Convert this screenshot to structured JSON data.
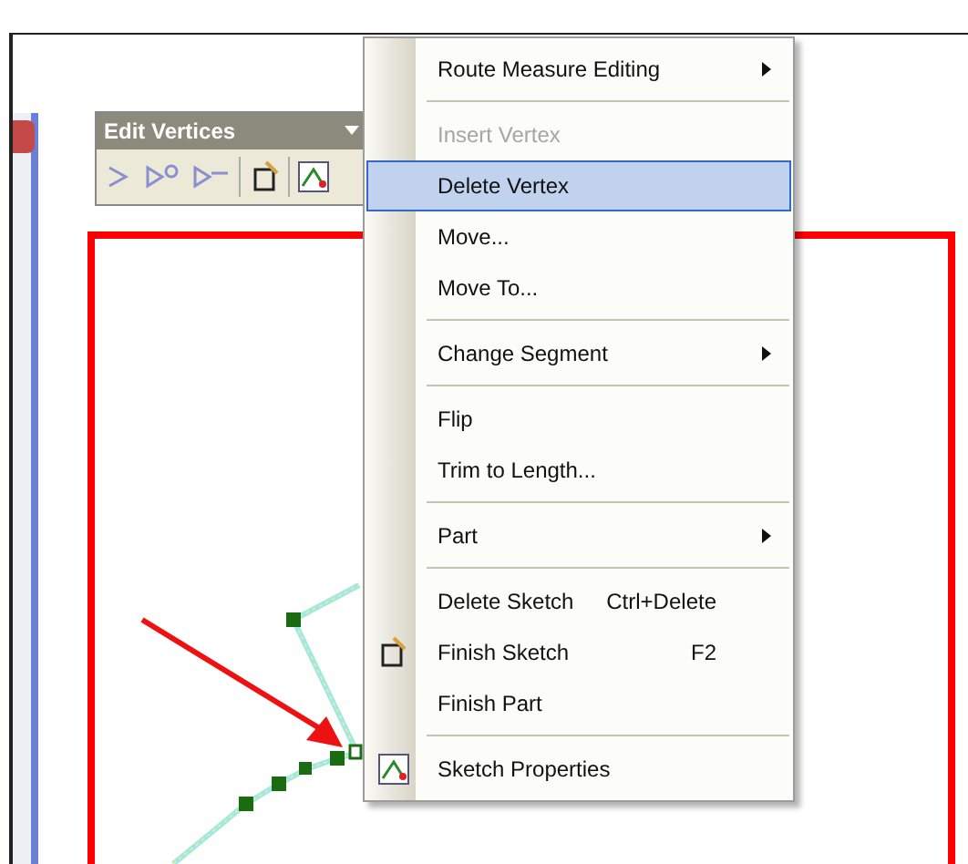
{
  "toolbar": {
    "title": "Edit Vertices"
  },
  "menu": {
    "items": [
      {
        "kind": "item",
        "label": "Route Measure Editing",
        "submenu": true,
        "disabled": false,
        "selected": false
      },
      {
        "kind": "separator"
      },
      {
        "kind": "item",
        "label": "Insert Vertex",
        "submenu": false,
        "disabled": true,
        "selected": false
      },
      {
        "kind": "item",
        "label": "Delete Vertex",
        "submenu": false,
        "disabled": false,
        "selected": true
      },
      {
        "kind": "item",
        "label": "Move...",
        "submenu": false,
        "disabled": false,
        "selected": false
      },
      {
        "kind": "item",
        "label": "Move To...",
        "submenu": false,
        "disabled": false,
        "selected": false
      },
      {
        "kind": "separator"
      },
      {
        "kind": "item",
        "label": "Change Segment",
        "submenu": true,
        "disabled": false,
        "selected": false
      },
      {
        "kind": "separator"
      },
      {
        "kind": "item",
        "label": "Flip",
        "submenu": false,
        "disabled": false,
        "selected": false
      },
      {
        "kind": "item",
        "label": "Trim to Length...",
        "submenu": false,
        "disabled": false,
        "selected": false
      },
      {
        "kind": "separator"
      },
      {
        "kind": "item",
        "label": "Part",
        "submenu": true,
        "disabled": false,
        "selected": false
      },
      {
        "kind": "separator"
      },
      {
        "kind": "item",
        "label": "Delete Sketch",
        "shortcut": "Ctrl+Delete",
        "submenu": false,
        "disabled": false,
        "selected": false
      },
      {
        "kind": "item",
        "label": "Finish Sketch",
        "shortcut": "F2",
        "submenu": false,
        "disabled": false,
        "selected": false
      },
      {
        "kind": "item",
        "label": "Finish Part",
        "submenu": false,
        "disabled": false,
        "selected": false
      },
      {
        "kind": "separator"
      },
      {
        "kind": "item",
        "label": "Sketch Properties",
        "submenu": false,
        "disabled": false,
        "selected": false
      }
    ]
  }
}
